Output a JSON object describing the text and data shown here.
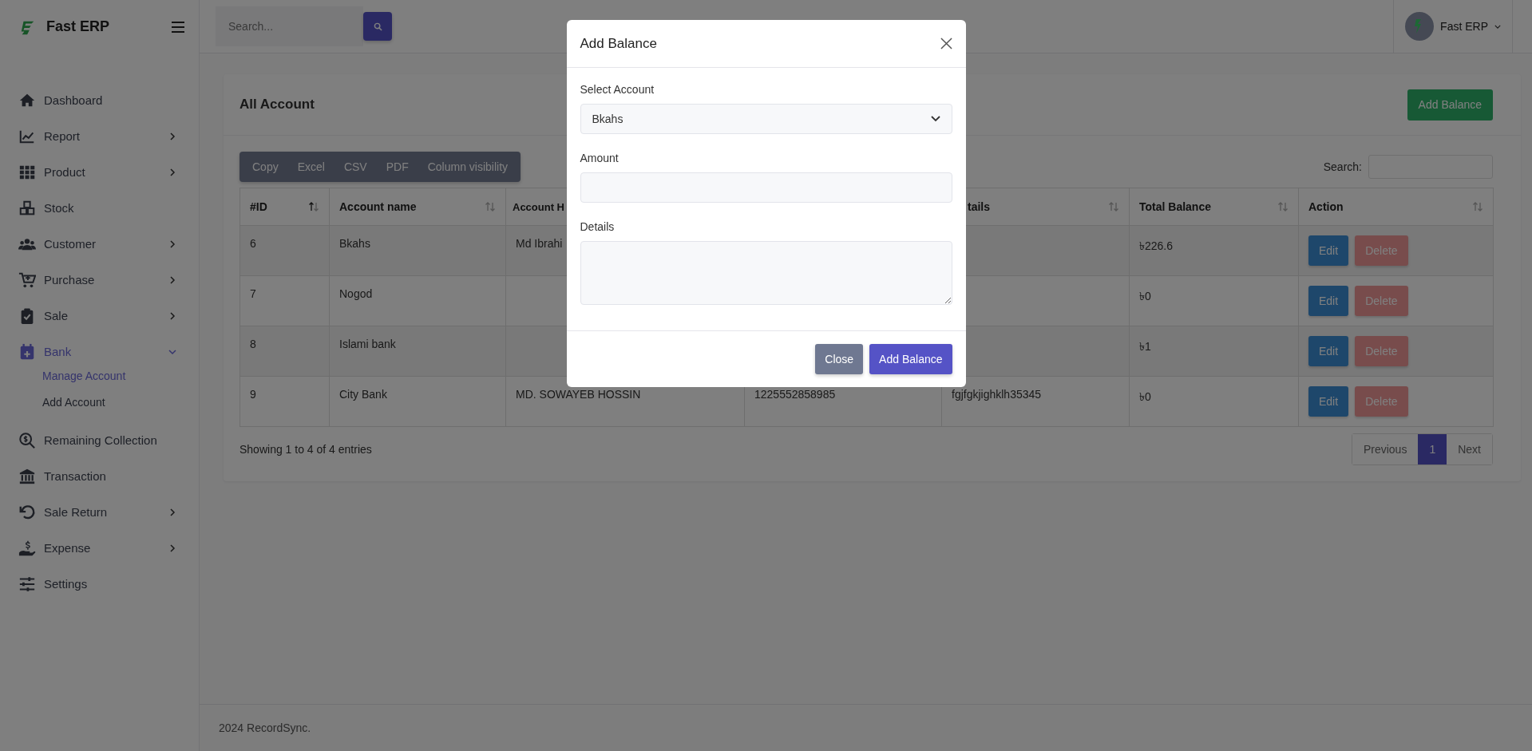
{
  "sidebar": {
    "brand": "Fast ERP",
    "items": [
      {
        "label": "Dashboard",
        "selected": false
      },
      {
        "label": "Report",
        "selected": false,
        "expanded": false
      },
      {
        "label": "Product",
        "selected": false,
        "expanded": false
      },
      {
        "label": "Stock",
        "selected": false
      },
      {
        "label": "Customer",
        "selected": false,
        "expanded": false
      },
      {
        "label": "Purchase",
        "selected": false,
        "expanded": false
      },
      {
        "label": "Sale",
        "selected": false,
        "expanded": false
      },
      {
        "label": "Bank",
        "selected": true,
        "expanded": true,
        "children": [
          {
            "label": "Manage Account",
            "selected": true
          },
          {
            "label": "Add Account",
            "selected": false
          }
        ]
      },
      {
        "label": "Remaining Collection",
        "selected": false
      },
      {
        "label": "Transaction",
        "selected": false
      },
      {
        "label": "Sale Return",
        "selected": false,
        "expanded": false
      },
      {
        "label": "Expense",
        "selected": false,
        "expanded": false
      },
      {
        "label": "Settings",
        "selected": false
      }
    ]
  },
  "header": {
    "search": {
      "placeholder": "Search..."
    },
    "user": {
      "name": "Fast ERP"
    }
  },
  "card": {
    "title": "All Account",
    "add_button": "Add Balance",
    "export_buttons": [
      "Copy",
      "Excel",
      "CSV",
      "PDF",
      "Column visibility"
    ],
    "search_label": "Search:",
    "table": {
      "columns": [
        {
          "label": "#ID",
          "sorted": true
        },
        {
          "label": "Account name",
          "sorted": false
        },
        {
          "label": "Account H"
        },
        {},
        {
          "label": "tails",
          "sorted": false
        },
        {
          "label": "Total Balance",
          "sorted": false
        },
        {
          "label": "Action",
          "sorted": false
        }
      ],
      "rows": [
        {
          "id": "6",
          "name": "Bkahs",
          "holder": "Md Ibrahi",
          "balance": "৳226.6",
          "actions": [
            "Edit",
            "Delete"
          ]
        },
        {
          "id": "7",
          "name": "Nogod",
          "balance": "৳0",
          "actions": [
            "Edit",
            "Delete"
          ]
        },
        {
          "id": "8",
          "name": "Islami bank",
          "balance": "৳1",
          "actions": [
            "Edit",
            "Delete"
          ]
        },
        {
          "id": "9",
          "name": "City Bank",
          "holder": "MD. SOWAYEB HOSSIN",
          "number": "1225552858985",
          "details": "fgjfgkjighklh35345",
          "balance": "৳0",
          "actions": [
            "Edit",
            "Delete"
          ]
        }
      ]
    },
    "info": "Showing 1 to 4 of 4 entries",
    "pagination": [
      {
        "label": "Previous",
        "selected": false
      },
      {
        "label": "1",
        "selected": true
      },
      {
        "label": "Next",
        "selected": false
      }
    ]
  },
  "footer": "2024 RecordSync.",
  "modal": {
    "title": "Add Balance",
    "fields": [
      {
        "kind": "select",
        "label": "Select Account",
        "value": "Bkahs"
      },
      {
        "kind": "input",
        "label": "Amount"
      },
      {
        "kind": "textarea",
        "label": "Details"
      }
    ],
    "buttons": [
      {
        "label": "Close",
        "kind": "secondary"
      },
      {
        "label": "Add Balance",
        "kind": "primary"
      }
    ]
  }
}
